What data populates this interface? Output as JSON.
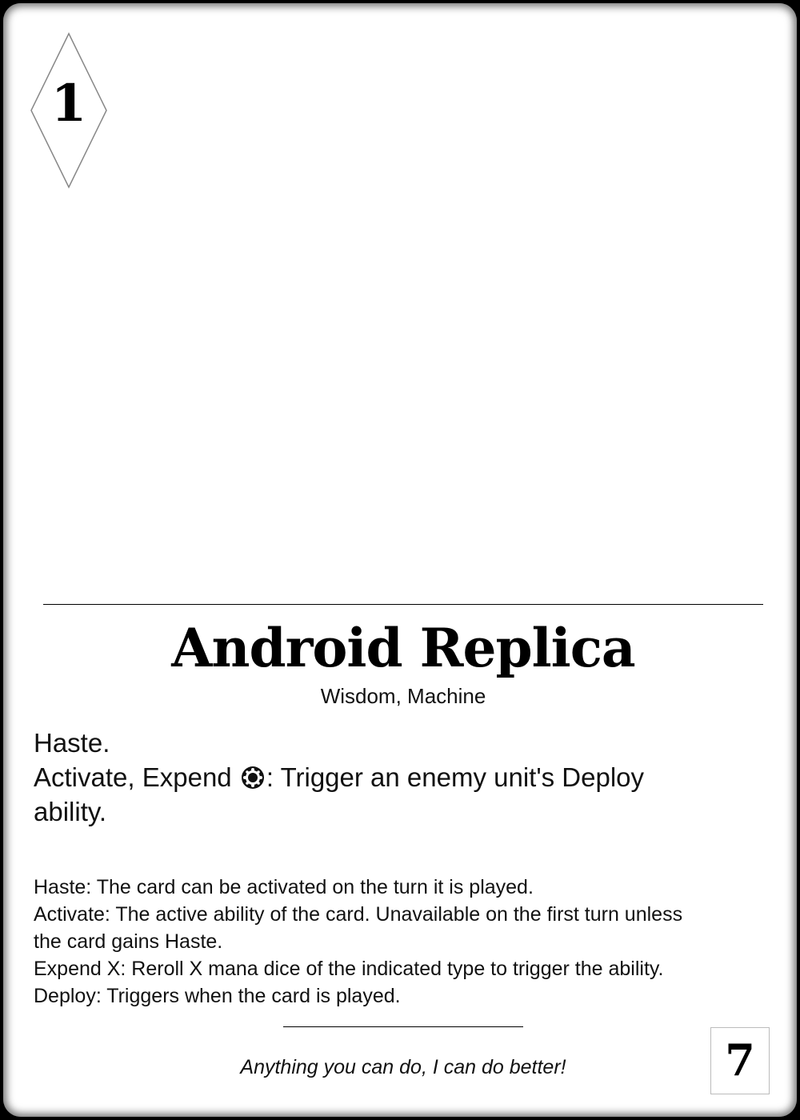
{
  "card": {
    "cost": "1",
    "name": "Android Replica",
    "types": "Wisdom, Machine",
    "abilities": {
      "line1": "Haste.",
      "line2_prefix": "Activate, Expend",
      "line2_icon": "wisdom-mana-icon",
      "line2_suffix": ": Trigger an enemy unit's Deploy",
      "line3": "ability."
    },
    "glossary": {
      "haste": "Haste: The card can be activated on the turn it is played.",
      "activate_line1": "Activate: The active ability of the card. Unavailable on the first turn unless",
      "activate_line2": "the card gains Haste.",
      "expend": "Expend X: Reroll X mana dice of the indicated type to trigger the ability.",
      "deploy": "Deploy: Triggers when the card is played."
    },
    "flavor": "Anything you can do, I can do better!",
    "power": "7"
  },
  "colors": {
    "border": "#000000",
    "face": "#ffffff",
    "text": "#111111"
  }
}
